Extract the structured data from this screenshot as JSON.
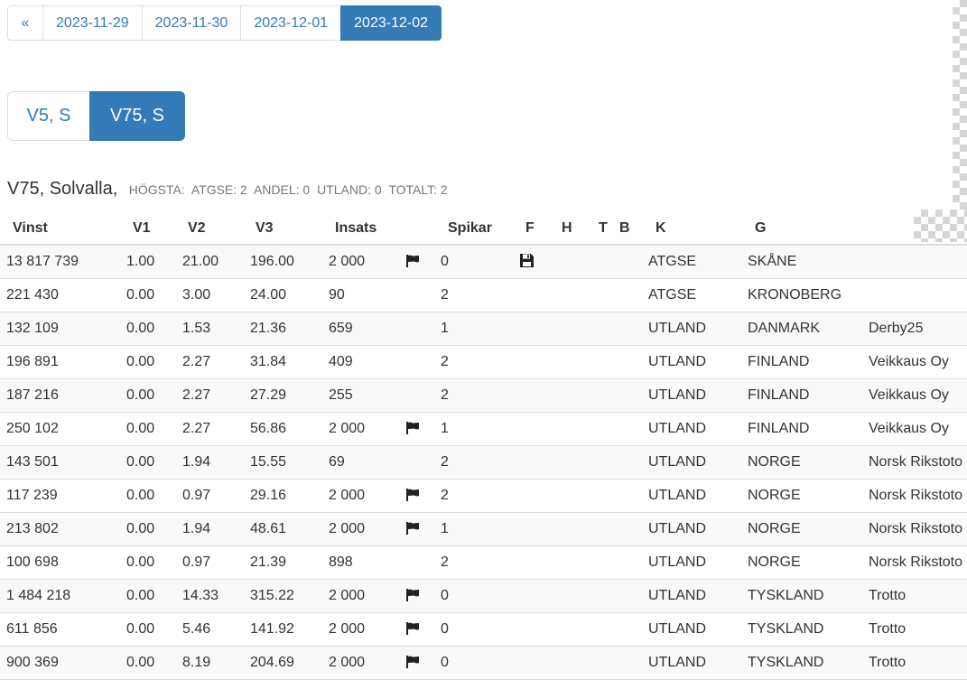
{
  "dates": {
    "prev_label": "«",
    "items": [
      {
        "label": "2023-11-29",
        "active": false
      },
      {
        "label": "2023-11-30",
        "active": false
      },
      {
        "label": "2023-12-01",
        "active": false
      },
      {
        "label": "2023-12-02",
        "active": true
      }
    ]
  },
  "races": {
    "items": [
      {
        "label": "V5, S",
        "active": false
      },
      {
        "label": "V75, S",
        "active": true
      }
    ]
  },
  "heading": {
    "title": "V75, Solvalla,",
    "stats": [
      "HÖGSTA:",
      "ATGSE: 2",
      "ANDEL: 0",
      "UTLAND: 0",
      "TOTALT: 2"
    ]
  },
  "table": {
    "columns": [
      "Vinst",
      "V1",
      "V2",
      "V3",
      "Insats",
      "Spikar",
      "F",
      "H",
      "T",
      "B",
      "K",
      "G"
    ],
    "rows": [
      {
        "vinst": "13 817 739",
        "v1": "1.00",
        "v2": "21.00",
        "v3": "196.00",
        "insats": "2 000",
        "flag": true,
        "spikar": "0",
        "saved": true,
        "k": "ATGSE",
        "g": "SKÅNE",
        "extra": ""
      },
      {
        "vinst": "221 430",
        "v1": "0.00",
        "v2": "3.00",
        "v3": "24.00",
        "insats": "90",
        "flag": false,
        "spikar": "2",
        "saved": false,
        "k": "ATGSE",
        "g": "KRONOBERG",
        "extra": ""
      },
      {
        "vinst": "132 109",
        "v1": "0.00",
        "v2": "1.53",
        "v3": "21.36",
        "insats": "659",
        "flag": false,
        "spikar": "1",
        "saved": false,
        "k": "UTLAND",
        "g": "DANMARK",
        "extra": "Derby25"
      },
      {
        "vinst": "196 891",
        "v1": "0.00",
        "v2": "2.27",
        "v3": "31.84",
        "insats": "409",
        "flag": false,
        "spikar": "2",
        "saved": false,
        "k": "UTLAND",
        "g": "FINLAND",
        "extra": "Veikkaus Oy"
      },
      {
        "vinst": "187 216",
        "v1": "0.00",
        "v2": "2.27",
        "v3": "27.29",
        "insats": "255",
        "flag": false,
        "spikar": "2",
        "saved": false,
        "k": "UTLAND",
        "g": "FINLAND",
        "extra": "Veikkaus Oy"
      },
      {
        "vinst": "250 102",
        "v1": "0.00",
        "v2": "2.27",
        "v3": "56.86",
        "insats": "2 000",
        "flag": true,
        "spikar": "1",
        "saved": false,
        "k": "UTLAND",
        "g": "FINLAND",
        "extra": "Veikkaus Oy"
      },
      {
        "vinst": "143 501",
        "v1": "0.00",
        "v2": "1.94",
        "v3": "15.55",
        "insats": "69",
        "flag": false,
        "spikar": "2",
        "saved": false,
        "k": "UTLAND",
        "g": "NORGE",
        "extra": "Norsk Rikstoto"
      },
      {
        "vinst": "117 239",
        "v1": "0.00",
        "v2": "0.97",
        "v3": "29.16",
        "insats": "2 000",
        "flag": true,
        "spikar": "2",
        "saved": false,
        "k": "UTLAND",
        "g": "NORGE",
        "extra": "Norsk Rikstoto"
      },
      {
        "vinst": "213 802",
        "v1": "0.00",
        "v2": "1.94",
        "v3": "48.61",
        "insats": "2 000",
        "flag": true,
        "spikar": "1",
        "saved": false,
        "k": "UTLAND",
        "g": "NORGE",
        "extra": "Norsk Rikstoto"
      },
      {
        "vinst": "100 698",
        "v1": "0.00",
        "v2": "0.97",
        "v3": "21.39",
        "insats": "898",
        "flag": false,
        "spikar": "2",
        "saved": false,
        "k": "UTLAND",
        "g": "NORGE",
        "extra": "Norsk Rikstoto"
      },
      {
        "vinst": "1 484 218",
        "v1": "0.00",
        "v2": "14.33",
        "v3": "315.22",
        "insats": "2 000",
        "flag": true,
        "spikar": "0",
        "saved": false,
        "k": "UTLAND",
        "g": "TYSKLAND",
        "extra": "Trotto"
      },
      {
        "vinst": "611 856",
        "v1": "0.00",
        "v2": "5.46",
        "v3": "141.92",
        "insats": "2 000",
        "flag": true,
        "spikar": "0",
        "saved": false,
        "k": "UTLAND",
        "g": "TYSKLAND",
        "extra": "Trotto"
      },
      {
        "vinst": "900 369",
        "v1": "0.00",
        "v2": "8.19",
        "v3": "204.69",
        "insats": "2 000",
        "flag": true,
        "spikar": "0",
        "saved": false,
        "k": "UTLAND",
        "g": "TYSKLAND",
        "extra": "Trotto"
      }
    ]
  },
  "colors": {
    "accent": "#337ab7",
    "border": "#dddddd",
    "stripe": "#f9f9f9",
    "muted": "#777777"
  }
}
